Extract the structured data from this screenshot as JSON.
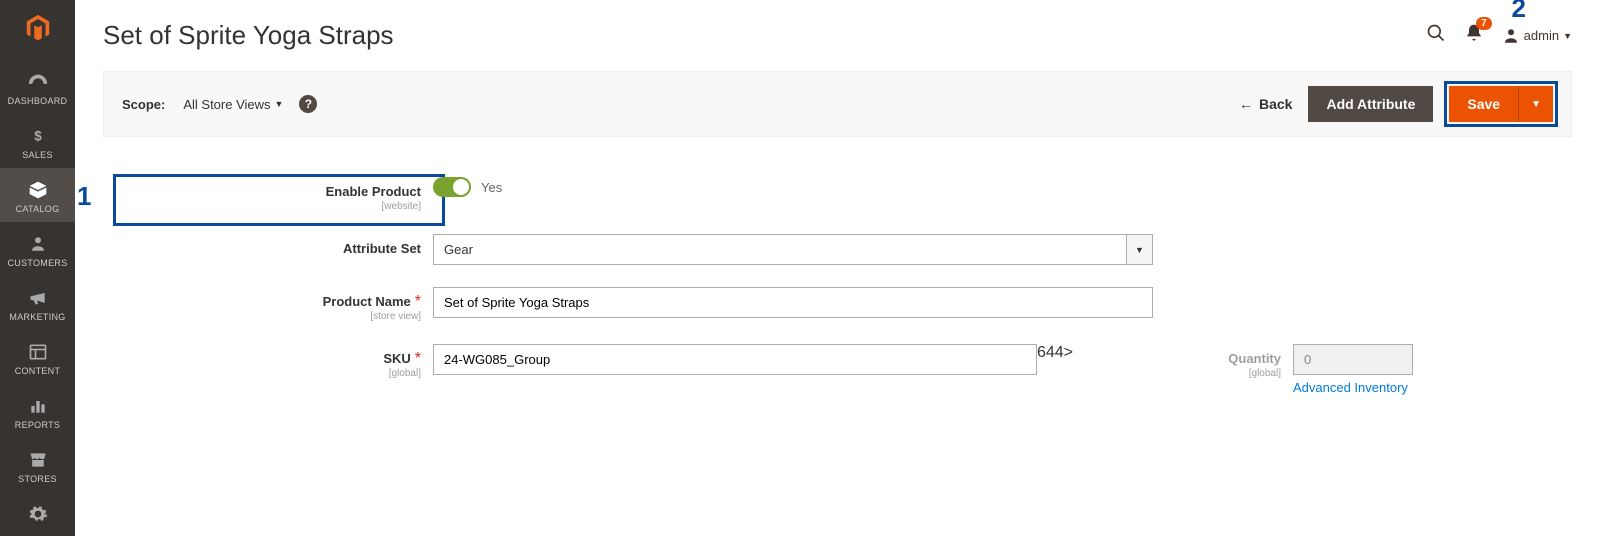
{
  "sidebar": {
    "items": [
      {
        "label": "DASHBOARD"
      },
      {
        "label": "SALES"
      },
      {
        "label": "CATALOG"
      },
      {
        "label": "CUSTOMERS"
      },
      {
        "label": "MARKETING"
      },
      {
        "label": "CONTENT"
      },
      {
        "label": "REPORTS"
      },
      {
        "label": "STORES"
      }
    ]
  },
  "header": {
    "title": "Set of Sprite Yoga Straps",
    "notification_count": "7",
    "admin_user": "admin"
  },
  "toolbar": {
    "scope_label": "Scope:",
    "scope_value": "All Store Views",
    "back_label": "Back",
    "add_attribute_label": "Add Attribute",
    "save_label": "Save"
  },
  "form": {
    "enable_product": {
      "label": "Enable Product",
      "sublabel": "[website]",
      "value_text": "Yes"
    },
    "attribute_set": {
      "label": "Attribute Set",
      "value": "Gear"
    },
    "product_name": {
      "label": "Product Name",
      "sublabel": "[store view]",
      "value": "Set of Sprite Yoga Straps"
    },
    "sku": {
      "label": "SKU",
      "sublabel": "[global]",
      "value": "24-WG085_Group"
    },
    "quantity": {
      "label": "Quantity",
      "sublabel": "[global]",
      "value": "0",
      "adv_link": "Advanced Inventory"
    }
  },
  "annotations": {
    "one": "1",
    "two": "2"
  }
}
